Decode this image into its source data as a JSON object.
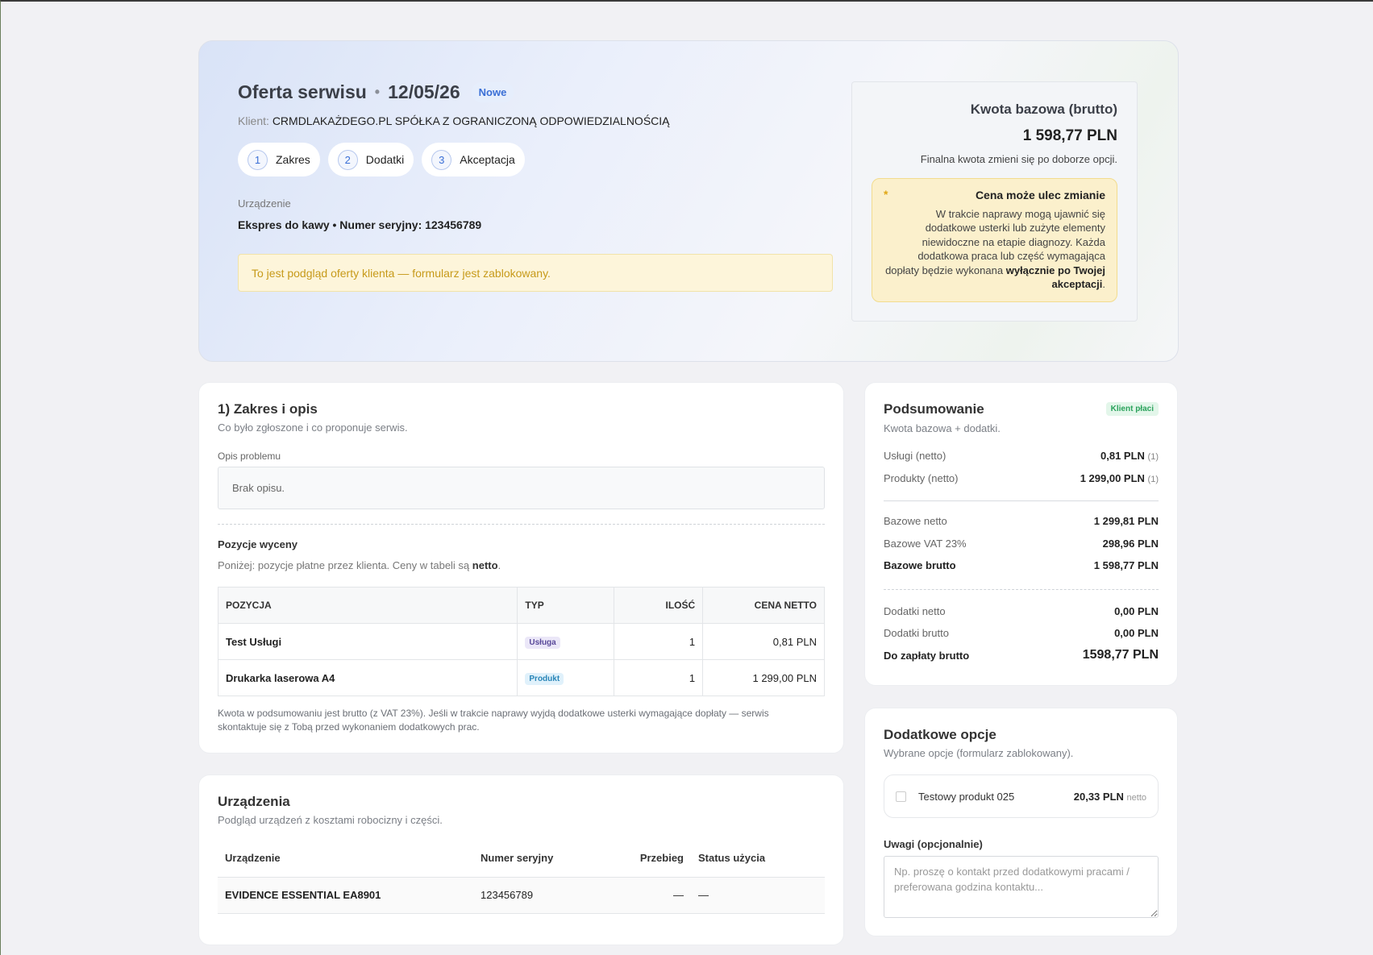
{
  "hero": {
    "title": "Oferta serwisu",
    "date": "12/05/26",
    "badge": "Nowe",
    "client_label": "Klient:",
    "client_name": "CRMDLAKAŻDEGO.PL SPÓŁKA Z OGRANICZONĄ ODPOWIEDZIALNOŚCIĄ",
    "steps": [
      {
        "num": "1",
        "label": "Zakres"
      },
      {
        "num": "2",
        "label": "Dodatki"
      },
      {
        "num": "3",
        "label": "Akceptacja"
      }
    ],
    "device_label": "Urządzenie",
    "device_value": "Ekspres do kawy • Numer seryjny: 123456789",
    "notice": "To jest podgląd oferty klienta — formularz jest zablokowany."
  },
  "price_box": {
    "title": "Kwota bazowa (brutto)",
    "amount": "1 598,77 PLN",
    "note": "Finalna kwota zmieni się po doborze opcji.",
    "warn_star": "*",
    "warn_title": "Cena może ulec zmianie",
    "warn_text": "W trakcie naprawy mogą ujawnić się dodatkowe usterki lub zużyte elementy niewidoczne na etapie diagnozy. Każda dodatkowa praca lub część wymagająca dopłaty będzie wykonana",
    "warn_bold": "wyłącznie po Twojej akceptacji",
    "warn_end": "."
  },
  "scope": {
    "title": "1) Zakres i opis",
    "subtitle": "Co było zgłoszone i co proponuje serwis.",
    "problem_label": "Opis problemu",
    "problem_value": "Brak opisu.",
    "positions_title": "Pozycje wyceny",
    "positions_sub": "Poniżej: pozycje płatne przez klienta. Ceny w tabeli są",
    "positions_sub_bold": "netto",
    "positions_sub_end": ".",
    "columns": [
      "POZYCJA",
      "TYP",
      "ILOŚĆ",
      "CENA NETTO"
    ],
    "rows": [
      {
        "name": "Test Usługi",
        "type": "Usługa",
        "qty": "1",
        "price": "0,81 PLN"
      },
      {
        "name": "Drukarka laserowa A4",
        "type": "Produkt",
        "qty": "1",
        "price": "1 299,00 PLN"
      }
    ],
    "footnote": "Kwota w podsumowaniu jest brutto (z VAT 23%). Jeśli w trakcie naprawy wyjdą dodatkowe usterki wymagające dopłaty — serwis skontaktuje się z Tobą przed wykonaniem dodatkowych prac."
  },
  "devices": {
    "title": "Urządzenia",
    "subtitle": "Podgląd urządzeń z kosztami robocizny i części.",
    "columns": [
      "Urządzenie",
      "Numer seryjny",
      "Przebieg",
      "Status użycia"
    ],
    "rows": [
      {
        "name": "EVIDENCE ESSENTIAL EA8901",
        "serial": "123456789",
        "mileage": "—",
        "status": "—"
      }
    ]
  },
  "summary": {
    "title": "Podsumowanie",
    "badge": "Klient płaci",
    "subtitle": "Kwota bazowa + dodatki.",
    "services_label": "Usługi (netto)",
    "services_value": "0,81 PLN",
    "services_count": "(1)",
    "products_label": "Produkty (netto)",
    "products_value": "1 299,00 PLN",
    "products_count": "(1)",
    "base_net_label": "Bazowe netto",
    "base_net_value": "1 299,81 PLN",
    "base_vat_label": "Bazowe VAT 23%",
    "base_vat_value": "298,96 PLN",
    "base_gross_label": "Bazowe brutto",
    "base_gross_value": "1 598,77 PLN",
    "extra_net_label": "Dodatki netto",
    "extra_net_value": "0,00 PLN",
    "extra_gross_label": "Dodatki brutto",
    "extra_gross_value": "0,00 PLN",
    "total_label": "Do zapłaty brutto",
    "total_value": "1598,77 PLN"
  },
  "options": {
    "title": "Dodatkowe opcje",
    "subtitle": "Wybrane opcje (formularz zablokowany).",
    "item_name": "Testowy produkt 025",
    "item_price": "20,33 PLN",
    "item_unit": "netto",
    "notes_label": "Uwagi (opcjonalnie)",
    "notes_placeholder": "Np. proszę o kontakt przed dodatkowymi pracami / preferowana godzina kontaktu..."
  }
}
